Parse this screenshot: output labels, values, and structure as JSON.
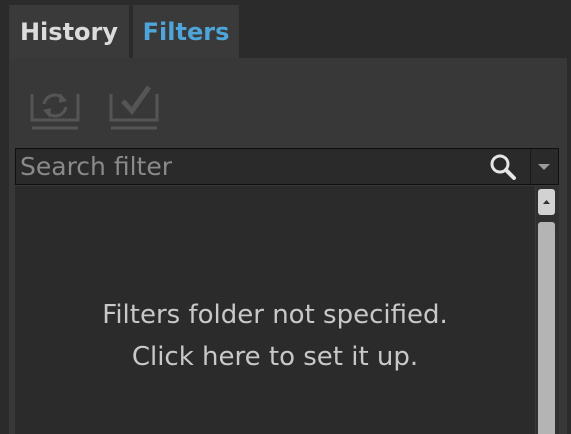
{
  "tabs": [
    {
      "label": "History"
    },
    {
      "label": "Filters"
    }
  ],
  "toolbar": {
    "refresh_icon": "refresh-folder-icon",
    "apply_icon": "apply-check-icon"
  },
  "search": {
    "placeholder": "Search filter",
    "value": ""
  },
  "empty_state": {
    "line1": "Filters folder not specified.",
    "line2": "Click here to set it up."
  },
  "colors": {
    "background": "#2b2b2b",
    "panel": "#383838",
    "active_tab_text": "#4ea5d9",
    "text": "#c8c8c8"
  }
}
